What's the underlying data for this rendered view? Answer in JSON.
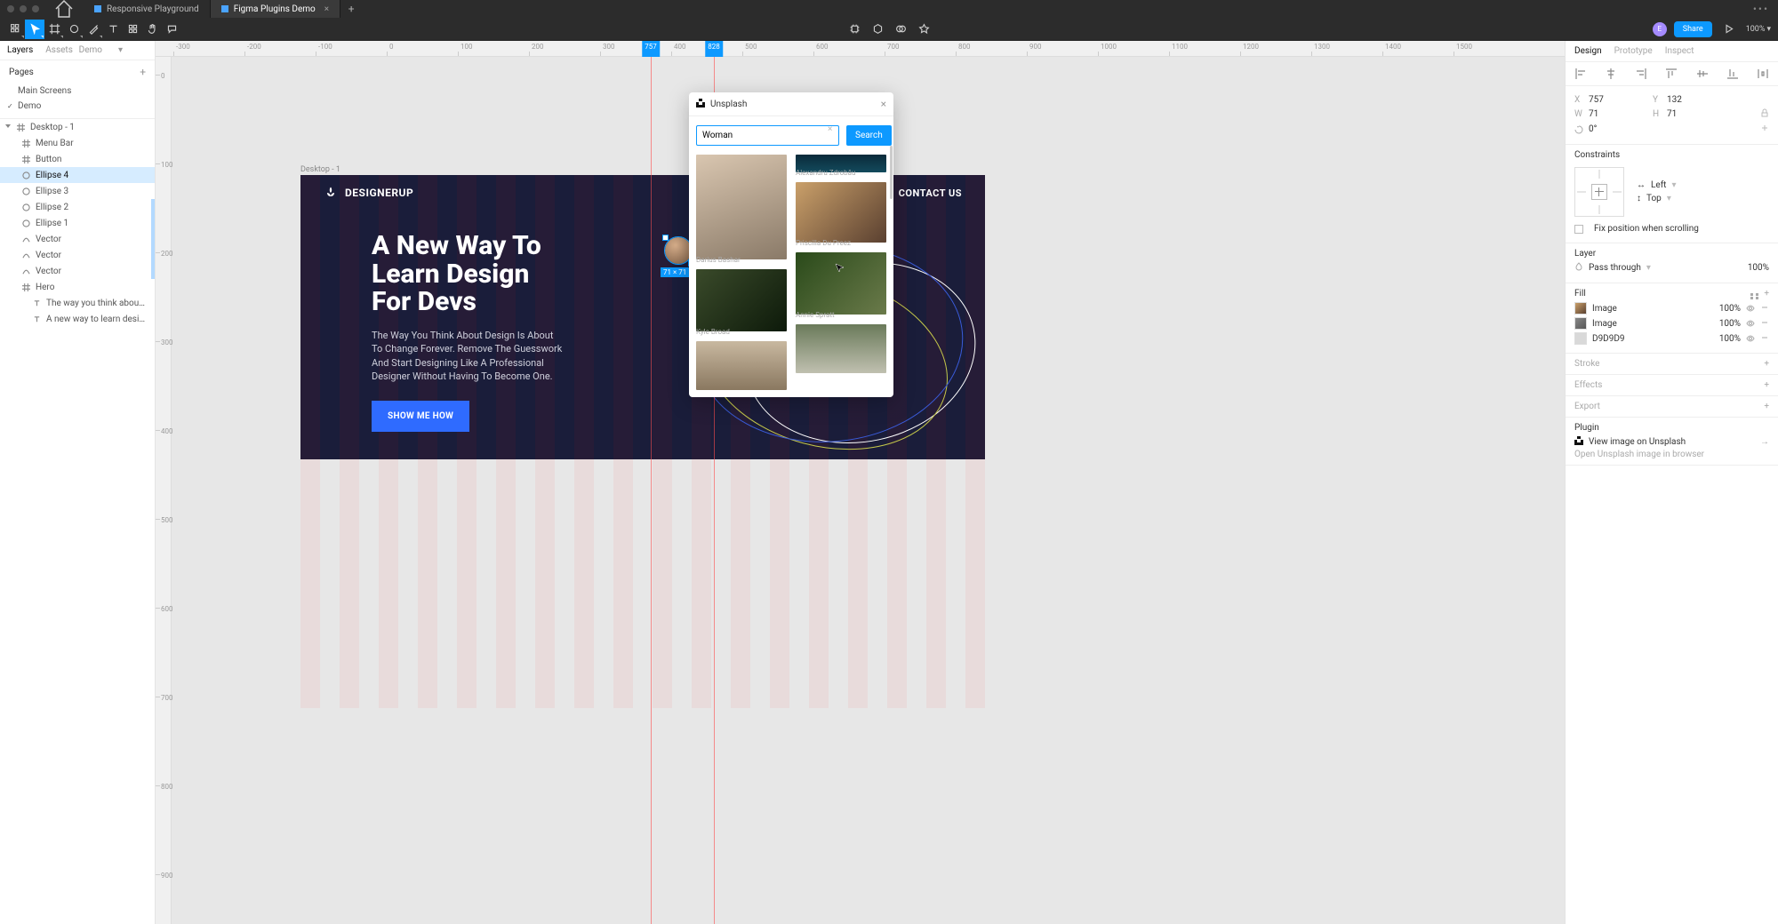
{
  "tabs": {
    "t1": "Responsive Playground",
    "t2": "Figma Plugins Demo"
  },
  "toolbar_right": {
    "avatar": "E",
    "share": "Share",
    "zoom": "100%"
  },
  "left": {
    "tab_layers": "Layers",
    "tab_assets": "Assets",
    "page_dd": "Demo",
    "pages_label": "Pages",
    "page1": "Main Screens",
    "page2": "Demo",
    "frame": "Desktop - 1",
    "layers": {
      "menu": "Menu Bar",
      "button": "Button",
      "e4": "Ellipse 4",
      "e3": "Ellipse 3",
      "e2": "Ellipse 2",
      "e1": "Ellipse 1",
      "v1": "Vector",
      "v2": "Vector",
      "v3": "Vector",
      "hero": "Hero",
      "t1": "The way you think about design is abo...",
      "t2": "A new way to learn design for devs"
    }
  },
  "canvas": {
    "frame_label": "Desktop - 1",
    "sel_dim": "71 × 71",
    "ruler_markers": {
      "a": "757",
      "b": "828"
    },
    "hticks": [
      "-300",
      "-200",
      "-100",
      "0",
      "100",
      "200",
      "300",
      "400",
      "500",
      "600",
      "700",
      "800",
      "900",
      "1000",
      "1100",
      "1200",
      "1300",
      "1400",
      "1500"
    ],
    "vticks": [
      "0",
      "100",
      "200",
      "300",
      "400",
      "500",
      "600",
      "700",
      "800",
      "900"
    ]
  },
  "artboard": {
    "logo": "DESIGNERUP",
    "contact": "CONTACT US",
    "title_l1": "A New Way To",
    "title_l2": "Learn Design",
    "title_l3": "For Devs",
    "sub": "The Way You Think About Design Is About To Change Forever. Remove The Guesswork And Start Designing Like A Professional Designer Without Having To Become One.",
    "cta": "SHOW ME HOW"
  },
  "plugin": {
    "name": "Unsplash",
    "search_value": "Woman",
    "search_btn": "Search",
    "credits": {
      "c1": "Darius Bashar",
      "c2": "Alexandru Zdrobău",
      "c3": "Priscilla Du Preez",
      "c4": "Kyle Broad",
      "c5": "Annie Spratt"
    }
  },
  "right": {
    "tab_design": "Design",
    "tab_proto": "Prototype",
    "tab_inspect": "Inspect",
    "X": "757",
    "Y": "132",
    "W": "71",
    "H": "71",
    "rot": "0°",
    "constraints": "Constraints",
    "c_left": "Left",
    "c_top": "Top",
    "fix": "Fix position when scrolling",
    "layer": "Layer",
    "blend": "Pass through",
    "opacity": "100%",
    "fill": "Fill",
    "fill_image": "Image",
    "fill_pct": "100%",
    "fill_hex": "D9D9D9",
    "stroke": "Stroke",
    "effects": "Effects",
    "export": "Export",
    "plugin": "Plugin",
    "plugin_link": "View image on Unsplash",
    "plugin_sub": "Open Unsplash image in browser"
  }
}
